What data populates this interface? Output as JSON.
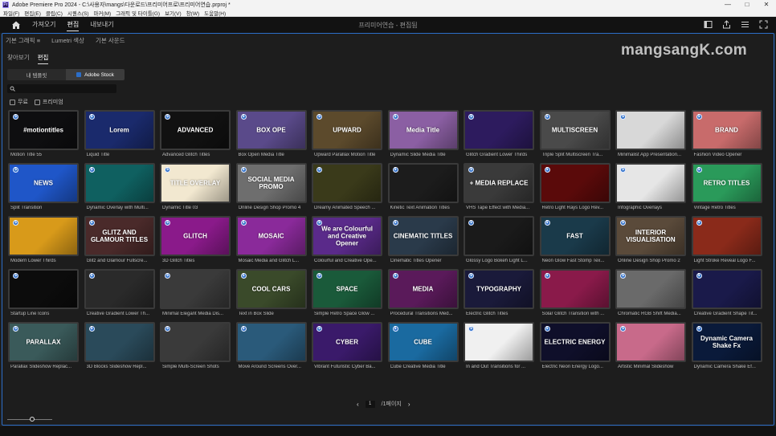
{
  "window": {
    "title": "Adobe Premiere Pro 2024 - C:\\사용자\\mangs\\다운로드\\프리미어프로\\프리미어연습.prproj *",
    "controls": [
      "—",
      "□",
      "✕"
    ]
  },
  "menu": [
    "파일(F)",
    "편집(E)",
    "클립(C)",
    "시퀀스(S)",
    "마커(M)",
    "그래픽 및 타이틀(G)",
    "보기(V)",
    "창(W)",
    "도움말(H)"
  ],
  "header": {
    "workspaces": [
      "가져오기",
      "편집",
      "내보내기"
    ],
    "active_workspace": "편집",
    "project_name": "프리미어연습 - 편집됨"
  },
  "panel": {
    "tabs": [
      "기본 그래픽",
      "≡",
      "Lumetri 색상",
      "기본 사운드"
    ],
    "subtabs": [
      "찾아보기",
      "편집"
    ],
    "active_subtab": "편집",
    "segments": [
      "내 템플릿",
      "Adobe Stock"
    ],
    "active_segment": "Adobe Stock",
    "search_placeholder": "",
    "filters": [
      "무료",
      "프리미엄"
    ]
  },
  "templates": [
    {
      "name": "Motion Title 55",
      "label": "#motiontitles",
      "bg": "#0e0e10"
    },
    {
      "name": "Liquid Title",
      "label": "Lorem",
      "bg": "#1a2a6c"
    },
    {
      "name": "Advanced Glitch Titles",
      "label": "ADVANCED",
      "bg": "#111"
    },
    {
      "name": "Box Open Media Title",
      "label": "BOX OPE",
      "bg": "#5a4a8a"
    },
    {
      "name": "Upward Parallax Motion Title",
      "label": "UPWARD",
      "bg": "#5c4a2c"
    },
    {
      "name": "Dynamic Slide Media Title",
      "label": "Media Title",
      "bg": "#8b5fa3"
    },
    {
      "name": "Glitch Gradient Lower Thirds",
      "label": "",
      "bg": "#2d1b5e"
    },
    {
      "name": "Triple Split Multiscreen Tra...",
      "label": "MULTISCREEN",
      "bg": "#4a4a4a"
    },
    {
      "name": "Minimalist App Presentation...",
      "label": "",
      "bg": "#d8d8d8"
    },
    {
      "name": "Fashion Video Opener",
      "label": "BRAND",
      "bg": "#c86b6b"
    },
    {
      "name": "Split Transition",
      "label": "NEWS",
      "bg": "#1f56c8"
    },
    {
      "name": "Dynamic Overlay with Multi...",
      "label": "",
      "bg": "#0f6060"
    },
    {
      "name": "Dynamic Title 03",
      "label": "TITLE OVERLAY",
      "bg": "#f2e8d0"
    },
    {
      "name": "Online Design Shop Promo 4",
      "label": "SOCIAL MEDIA PROMO",
      "bg": "#6e6e6e"
    },
    {
      "name": "Dreamy Animated Speech ...",
      "label": "",
      "bg": "#3a3a1a"
    },
    {
      "name": "Kinetic Text Animation Titles",
      "label": "",
      "bg": "#1c1c1c"
    },
    {
      "name": "VHS Tape Effect with Media...",
      "label": "+ MEDIA REPLACE",
      "bg": "#3a3a3a"
    },
    {
      "name": "Retro Light Rays Logo Rev...",
      "label": "",
      "bg": "#5a0a0a"
    },
    {
      "name": "Infographic Overlays",
      "label": "",
      "bg": "#e6e6e6"
    },
    {
      "name": "Vintage Retro Titles",
      "label": "RETRO TITLES",
      "bg": "#2a9a5a"
    },
    {
      "name": "Modern Lower Thirds",
      "label": "",
      "bg": "#d89a1a"
    },
    {
      "name": "Glitz and Glamour Fullscre...",
      "label": "GLITZ AND GLAMOUR TITLES",
      "bg": "#4a2a2a"
    },
    {
      "name": "3D Glitch Titles",
      "label": "GLITCH",
      "bg": "#8a1a8a"
    },
    {
      "name": "Mosaic Media and Glitch L...",
      "label": "MOSAIC",
      "bg": "#8a2a9a"
    },
    {
      "name": "Colourful and Creative Ope...",
      "label": "We are Colourful and Creative Opener",
      "bg": "#5a2a8a"
    },
    {
      "name": "Cinematic Titles Opener",
      "label": "CINEMATIC TITLES",
      "bg": "#2a3a4a"
    },
    {
      "name": "Glossy Logo Bokeh Light L...",
      "label": "",
      "bg": "#1a1a1a"
    },
    {
      "name": "Neon Glow Fast Stomp Tex...",
      "label": "FAST",
      "bg": "#1a3a4a"
    },
    {
      "name": "Online Design Shop Promo 2",
      "label": "INTERIOR VISUALISATION",
      "bg": "#5a4a3a"
    },
    {
      "name": "Light Stroke Reveal Logo F...",
      "label": "",
      "bg": "#8a2a1a"
    },
    {
      "name": "Startup Line Icons",
      "label": "",
      "bg": "#0c0c0c"
    },
    {
      "name": "Creative Gradient Lower Th...",
      "label": "",
      "bg": "#2a2a2a"
    },
    {
      "name": "Minimal Elegant Media Dis...",
      "label": "",
      "bg": "#3a3a3a"
    },
    {
      "name": "Text in Box Slide",
      "label": "COOL CARS",
      "bg": "#3a4a2a"
    },
    {
      "name": "Simple Retro Space Glow ...",
      "label": "SPACE",
      "bg": "#1a5a3a"
    },
    {
      "name": "Procedural Transitions Med...",
      "label": "MEDIA",
      "bg": "#5a1a5a"
    },
    {
      "name": "Electric Glitch Titles",
      "label": "TYPOGRAPHY",
      "bg": "#1a1a3a"
    },
    {
      "name": "Solar Glitch Transition with ...",
      "label": "",
      "bg": "#8a1a4a"
    },
    {
      "name": "Chromatic RGB Shift Media...",
      "label": "",
      "bg": "#6a6a6a"
    },
    {
      "name": "Creative Gradient Shape Tit...",
      "label": "",
      "bg": "#1a1a4a"
    },
    {
      "name": "Parallax Slideshow Replac...",
      "label": "PARALLAX",
      "bg": "#3a5a5a"
    },
    {
      "name": "3D Blocks Slideshow Repl...",
      "label": "",
      "bg": "#2a4a5a"
    },
    {
      "name": "Simple Multi-Screen Shots",
      "label": "",
      "bg": "#3a3a3a"
    },
    {
      "name": "Move Around Screens Over...",
      "label": "",
      "bg": "#2a5a7a"
    },
    {
      "name": "Vibrant Futuristic Cyber Ba...",
      "label": "CYBER",
      "bg": "#3a1a6a"
    },
    {
      "name": "Cube Creative Media Title",
      "label": "CUBE",
      "bg": "#1a6aa0"
    },
    {
      "name": "In and Out Transitions for ...",
      "label": "",
      "bg": "#f0f0f0"
    },
    {
      "name": "Electric Neon Energy Logo...",
      "label": "ELECTRIC ENERGY",
      "bg": "#0f0f2a"
    },
    {
      "name": "Artistic Minimal Slideshow",
      "label": "",
      "bg": "#c86a8a"
    },
    {
      "name": "Dynamic Camera Shake Ef...",
      "label": "Dynamic Camera Shake Fx",
      "bg": "#0a1a3a"
    }
  ],
  "pager": {
    "prev": "‹",
    "page": "1",
    "label": "/1페이지",
    "next": "›"
  },
  "zoom": {
    "level": 0.55
  },
  "watermark": "mangsangK.com"
}
